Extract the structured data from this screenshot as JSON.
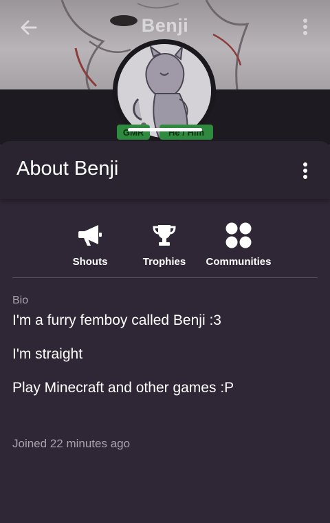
{
  "header": {
    "title": "Benji",
    "back_icon": "arrow-left-icon",
    "menu_icon": "more-vertical-icon"
  },
  "profile": {
    "tags": {
      "level": "GMR",
      "pronouns": "He / Him"
    }
  },
  "sheet": {
    "title": "About Benji",
    "menu_icon": "more-vertical-icon"
  },
  "tabs": [
    {
      "label": "Shouts",
      "icon": "megaphone-icon"
    },
    {
      "label": "Trophies",
      "icon": "trophy-icon"
    },
    {
      "label": "Communities",
      "icon": "communities-icon"
    }
  ],
  "bio": {
    "label": "Bio",
    "lines": [
      "I'm a furry femboy called Benji :3",
      "I'm straight",
      "Play Minecraft and other games :P"
    ]
  },
  "joined": "Joined 22 minutes ago",
  "colors": {
    "background": "#2f2735",
    "header_bar": "#2a2430",
    "tag_green": "#2e8a3e",
    "muted_text": "#a9a3ad"
  }
}
